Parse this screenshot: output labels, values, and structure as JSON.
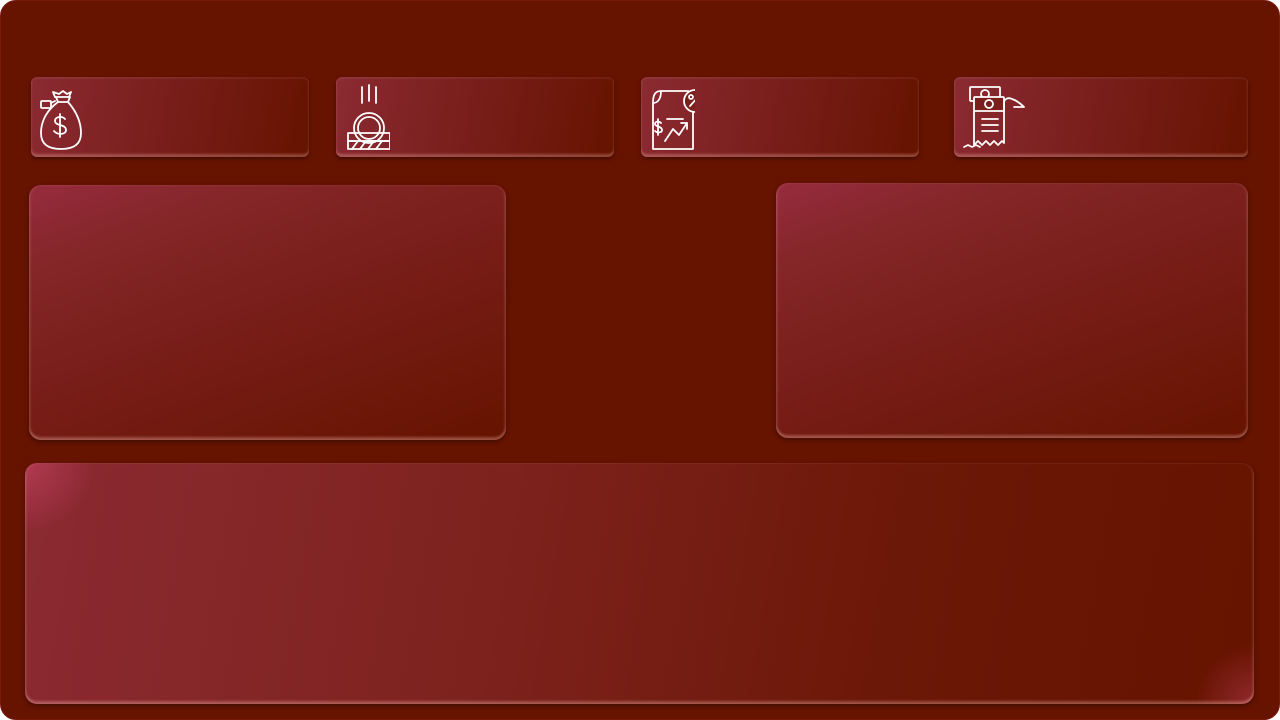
{
  "dashboard": {
    "kpi_cards": [
      {
        "icon": "money-bag-icon"
      },
      {
        "icon": "coin-drop-icon"
      },
      {
        "icon": "financial-report-icon"
      },
      {
        "icon": "bill-receipt-icon"
      }
    ],
    "colors": {
      "background": "#661300",
      "card_highlight": "#8b2a32",
      "icon_stroke": "#ffffff"
    }
  }
}
